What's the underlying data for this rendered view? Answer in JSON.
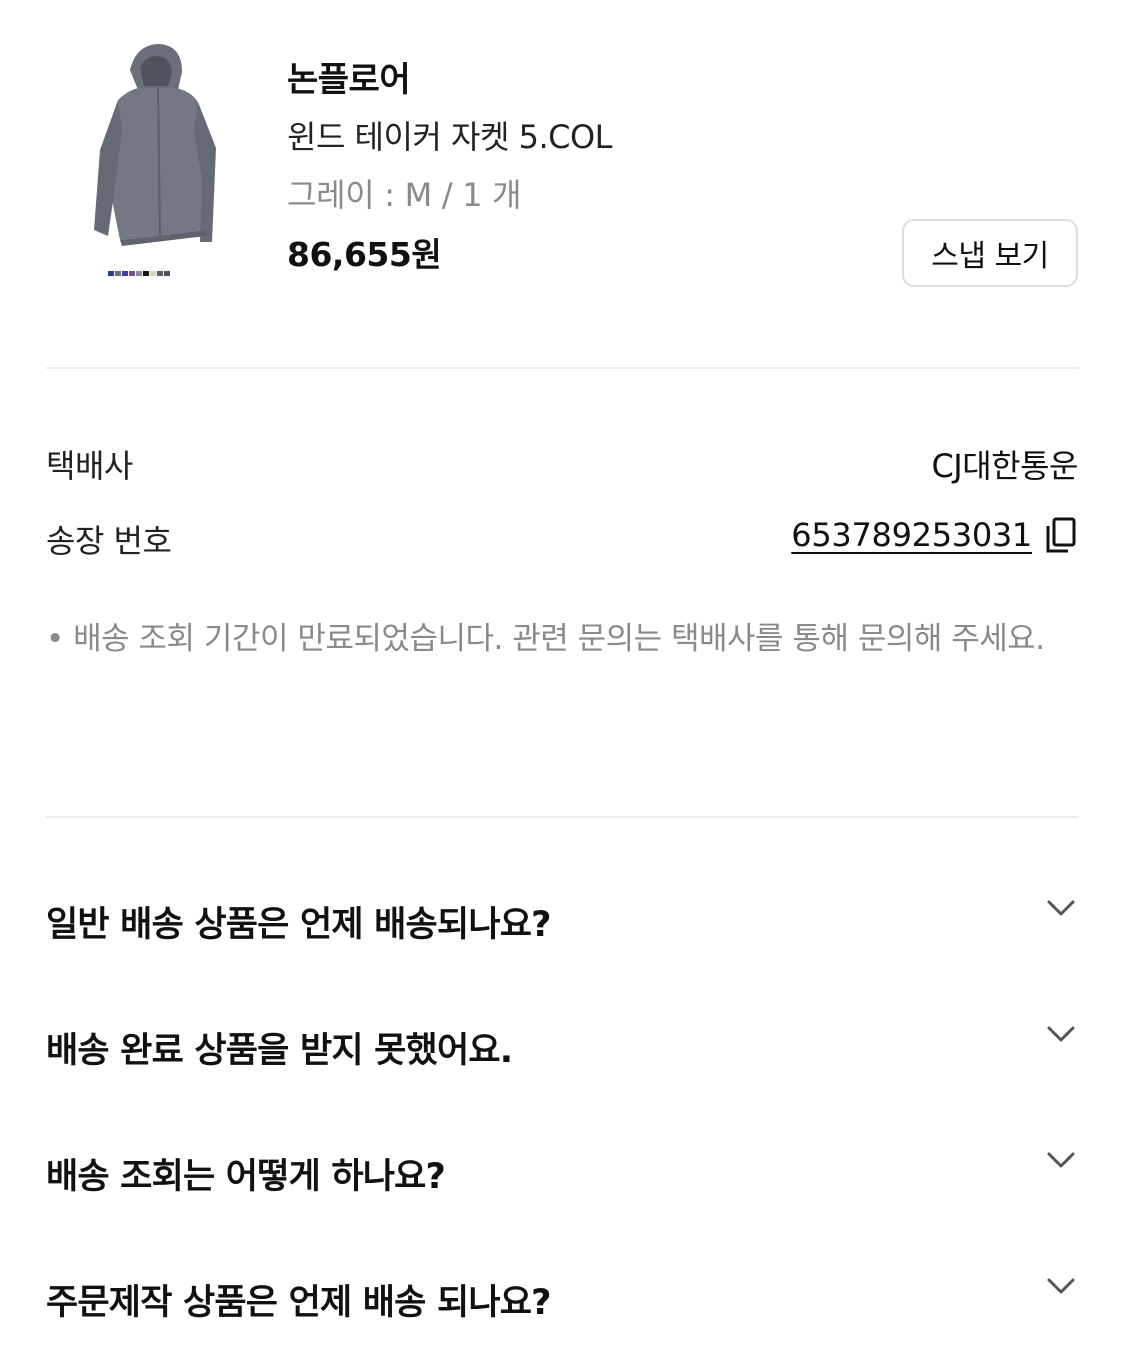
{
  "product": {
    "brand": "논플로어",
    "name": "윈드 테이커 자켓 5.COL",
    "option": "그레이 : M / 1 개",
    "price": "86,655원",
    "snap_button": "스냅 보기",
    "image_icon": "hooded-jacket-image"
  },
  "shipping": {
    "courier_label": "택배사",
    "courier_value": "CJ대한통운",
    "tracking_label": "송장 번호",
    "tracking_value": "653789253031",
    "copy_icon": "copy-icon",
    "notice": "• 배송 조회 기간이 만료되었습니다. 관련 문의는 택배사를 통해 문의해 주세요."
  },
  "faq": [
    {
      "question": "일반 배송 상품은 언제 배송되나요?"
    },
    {
      "question": "배송 완료 상품을 받지 못했어요."
    },
    {
      "question": "배송 조회는 어떻게 하나요?"
    },
    {
      "question": "주문제작 상품은 언제 배송 되나요?"
    }
  ],
  "colors": {
    "text_primary": "#111111",
    "text_secondary": "#8a8a8a",
    "divider": "#ececec",
    "button_border": "#dedede",
    "jacket_gray": "#6f7380"
  }
}
